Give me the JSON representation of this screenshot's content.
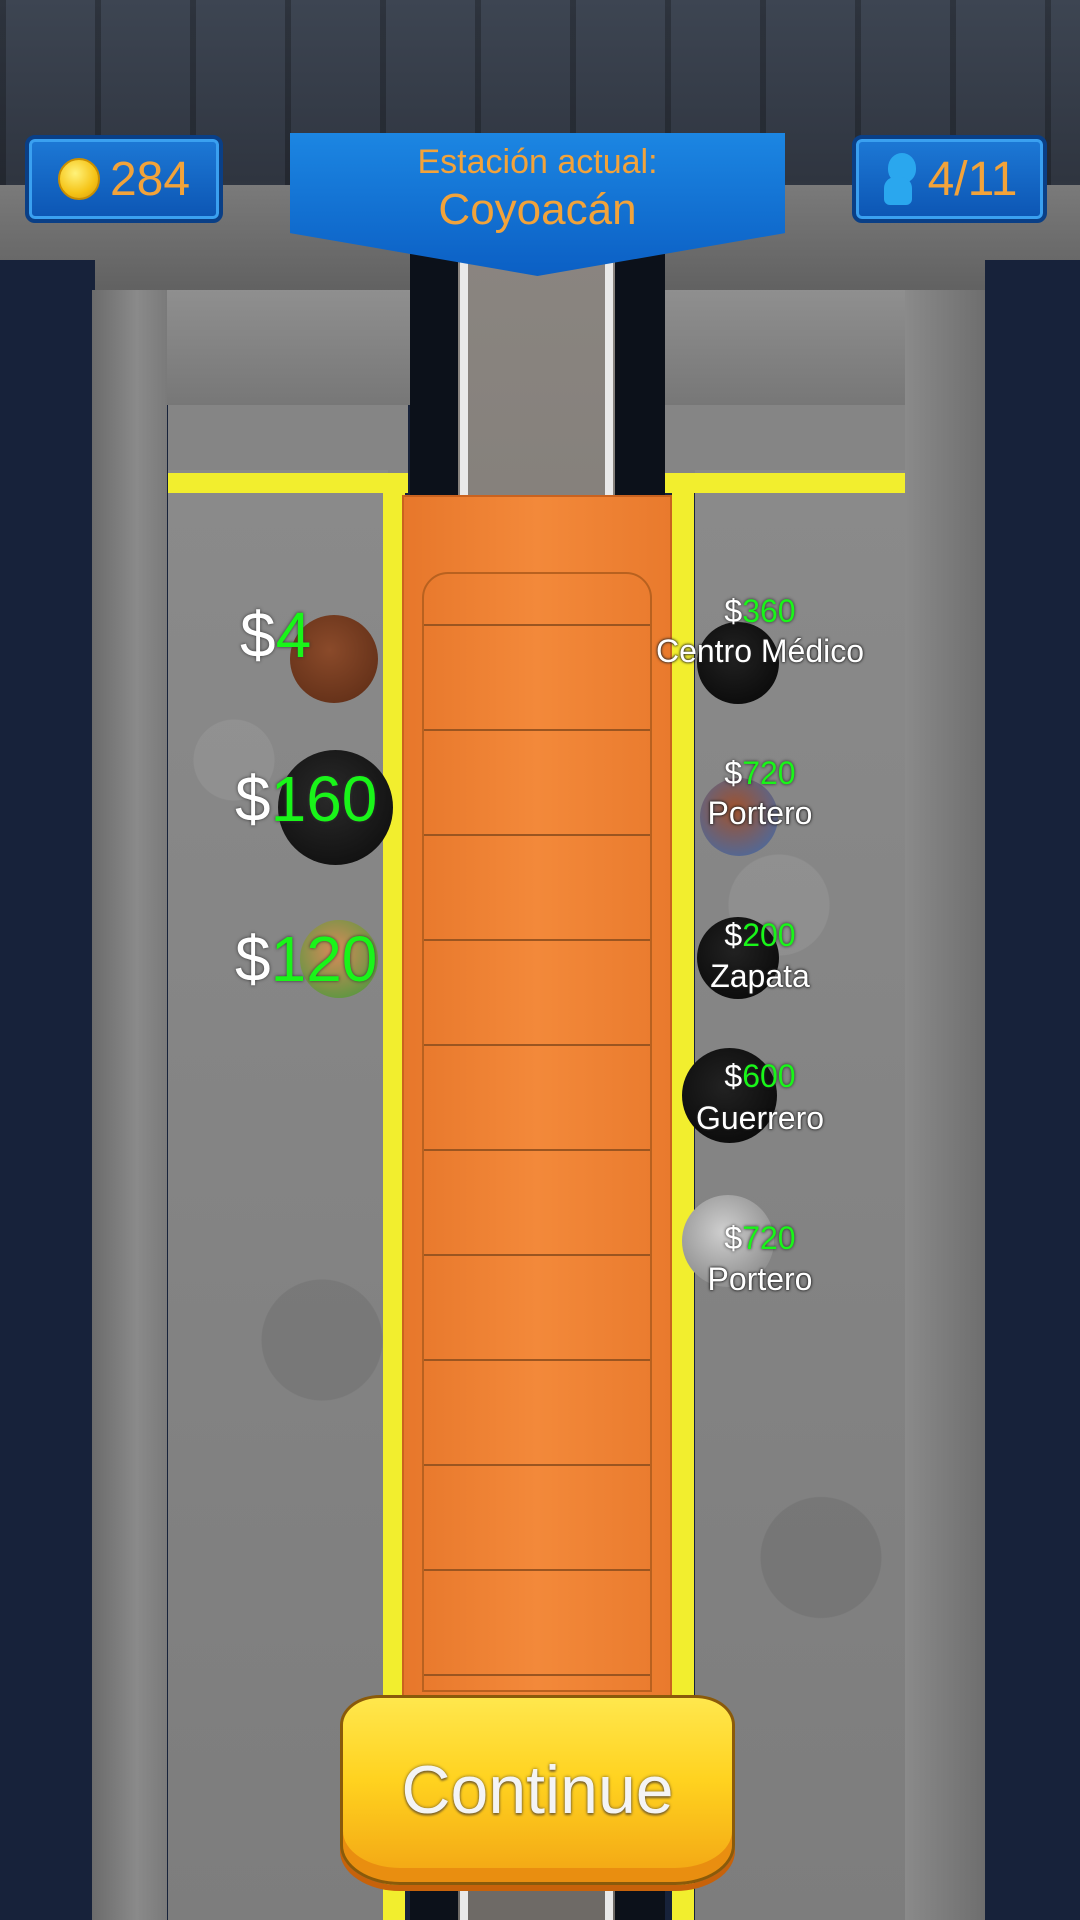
{
  "hud": {
    "coins": "284",
    "coin_icon": "coin-icon",
    "passengers": "4/11",
    "passenger_icon": "passenger-icon"
  },
  "station": {
    "label": "Estación actual:",
    "name": "Coyoacán"
  },
  "waiting_passengers": [
    {
      "symbol": "$",
      "amount": "4"
    },
    {
      "symbol": "$",
      "amount": "160"
    },
    {
      "symbol": "$",
      "amount": "120"
    }
  ],
  "onboard_passengers": [
    {
      "symbol": "$",
      "amount": "360",
      "destination": "Centro Médico"
    },
    {
      "symbol": "$",
      "amount": "720",
      "destination": "Portero"
    },
    {
      "symbol": "$",
      "amount": "200",
      "destination": "Zapata"
    },
    {
      "symbol": "$",
      "amount": "600",
      "destination": "Guerrero"
    },
    {
      "symbol": "$",
      "amount": "720",
      "destination": "Portero"
    }
  ],
  "continue_label": "Continue",
  "colors": {
    "hud_blue": "#0c55b3",
    "hud_text": "#f2a33a",
    "money_green": "#19f519",
    "train_orange": "#f3893a",
    "platform_edge_yellow": "#f2ee2e",
    "button_yellow": "#ffd21f"
  }
}
